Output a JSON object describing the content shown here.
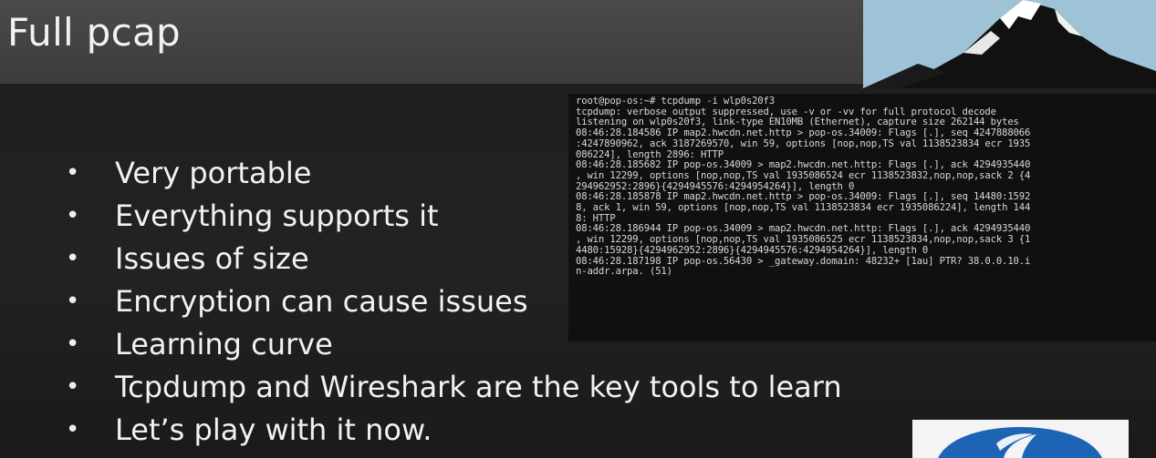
{
  "slide": {
    "title": "Full pcap",
    "bullets": [
      "Very portable",
      "Everything supports it",
      "Issues of size",
      "Encryption can cause issues",
      "Learning curve",
      "Tcpdump and Wireshark  are the key tools to learn",
      "Let’s play with it now."
    ],
    "bullet_marker": "•"
  },
  "terminal": {
    "lines": [
      "root@pop-os:~# tcpdump -i wlp0s20f3",
      "tcpdump: verbose output suppressed, use -v or -vv for full protocol decode",
      "listening on wlp0s20f3, link-type EN10MB (Ethernet), capture size 262144 bytes",
      "08:46:28.184586 IP map2.hwcdn.net.http > pop-os.34009: Flags [.], seq 4247888066",
      ":4247890962, ack 3187269570, win 59, options [nop,nop,TS val 1138523834 ecr 1935",
      "086224], length 2896: HTTP",
      "08:46:28.185682 IP pop-os.34009 > map2.hwcdn.net.http: Flags [.], ack 4294935440",
      ", win 12299, options [nop,nop,TS val 1935086524 ecr 1138523832,nop,nop,sack 2 {4",
      "294962952:2896}{4294945576:4294954264}], length 0",
      "08:46:28.185878 IP map2.hwcdn.net.http > pop-os.34009: Flags [.], seq 14480:1592",
      "8, ack 1, win 59, options [nop,nop,TS val 1138523834 ecr 1935086224], length 144",
      "8: HTTP",
      "08:46:28.186944 IP pop-os.34009 > map2.hwcdn.net.http: Flags [.], ack 4294935440",
      ", win 12299, options [nop,nop,TS val 1935086525 ecr 1138523834,nop,nop,sack 3 {1",
      "4480:15928}{4294962952:2896}{4294945576:4294954264}], length 0",
      "08:46:28.187198 IP pop-os.56430 > _gateway.domain: 48232+ [1au] PTR? 38.0.0.10.i",
      "n-addr.arpa. (51)"
    ]
  },
  "colors": {
    "background": "#1f1f1f",
    "title_band": "#444444",
    "text": "#f2f2f2",
    "terminal_bg": "#101010",
    "terminal_text": "#d8d8d8",
    "sky": "#9ec2d6",
    "logo_blue": "#1e64b4"
  },
  "icons": {
    "top_right": "mountain-logo-icon",
    "bottom_right": "circular-blue-logo-icon"
  }
}
